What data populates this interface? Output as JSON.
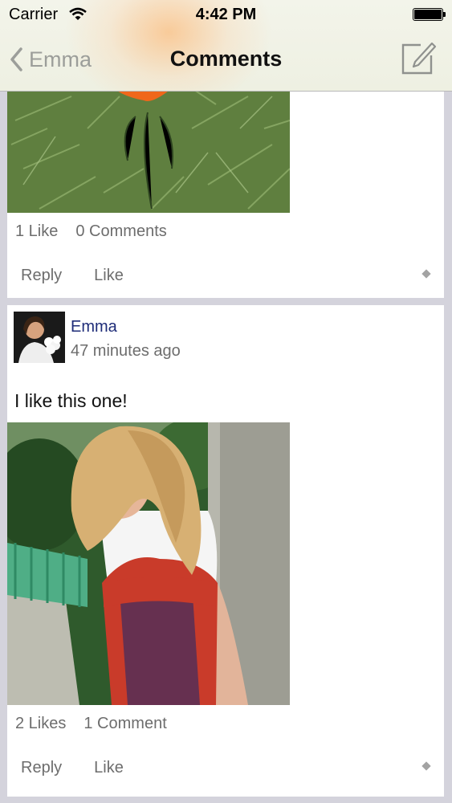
{
  "status_bar": {
    "carrier": "Carrier",
    "time": "4:42 PM"
  },
  "nav": {
    "back_label": "Emma",
    "title": "Comments"
  },
  "posts": [
    {
      "image": "flower-photo",
      "likes": "1 Like",
      "comments": "0 Comments",
      "reply_label": "Reply",
      "like_label": "Like"
    },
    {
      "author": "Emma",
      "time_ago": "47 minutes ago",
      "text": "I like this one!",
      "image": "woman-in-scarf-photo",
      "likes": "2 Likes",
      "comments": "1 Comment",
      "reply_label": "Reply",
      "like_label": "Like"
    }
  ],
  "colors": {
    "author_link": "#1e2c78",
    "meta_text": "#6d6d6d",
    "feed_bg": "#d4d3dc"
  }
}
